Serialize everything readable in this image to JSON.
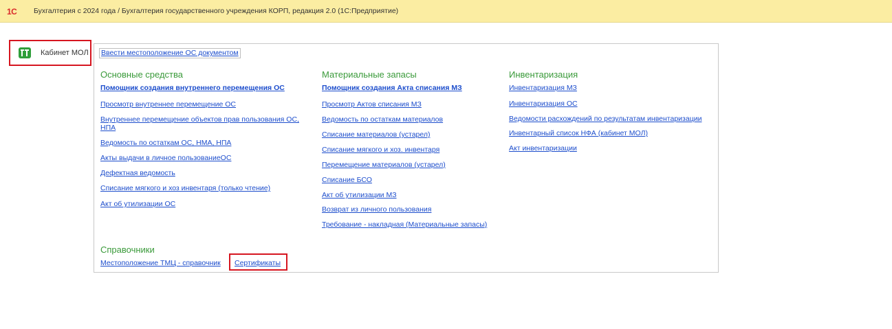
{
  "window": {
    "logo": "1С",
    "title": "Бухгалтерия с 2024 года / Бухгалтерия государственного учреждения КОРП, редакция 2.0  (1С:Предприятие)"
  },
  "sidebar": {
    "item_label": "Кабинет МОЛ",
    "item_icon": "green-pt-icon",
    "accent": "#2e9e3a"
  },
  "top_link": "Ввести местоположение ОС документом",
  "sections": {
    "os": {
      "title": "Основные средства",
      "links": [
        "Помощник создания внутреннего перемещения ОС",
        "Просмотр внутреннее перемещение ОС",
        "Внутреннее перемещение объектов прав пользования ОС,",
        "НПА",
        "Ведомость по остаткам ОС, НМА, НПА",
        "Акты выдачи в личное пользованиеОС",
        "Дефектная ведомость",
        "Списание мягкого и хоз инвентаря (только чтение)",
        "Акт об утилизации ОС"
      ]
    },
    "mz": {
      "title": "Материальные запасы",
      "links": [
        "Помощник создания Акта списания МЗ",
        "Просмотр Актов списания МЗ",
        "Ведомость по остаткам материалов",
        "Списание материалов (устарел)",
        "Списание мягкого и хоз. инвентаря",
        "Перемещение материалов (устарел)",
        "Списание БСО",
        "Акт об утилизации МЗ",
        "Возврат из личного пользования",
        "Требование - накладная (Материальные запасы)"
      ]
    },
    "inv": {
      "title": "Инвентаризация",
      "links": [
        "Инвентаризация МЗ",
        "Инвентаризация ОС",
        "Ведомости расхождений по результатам инвентаризации",
        "Инвентарный список НФА (кабинет МОЛ)",
        "Акт инвентаризации"
      ]
    },
    "ref": {
      "title": "Справочники",
      "links": [
        "Местоположение ТМЦ - справочник",
        "Сертификаты"
      ]
    }
  },
  "colors": {
    "link": "#1c4dcc",
    "section_title": "#3a9a3a",
    "highlight": "#d6151f",
    "titlebar": "#fbeda2"
  }
}
